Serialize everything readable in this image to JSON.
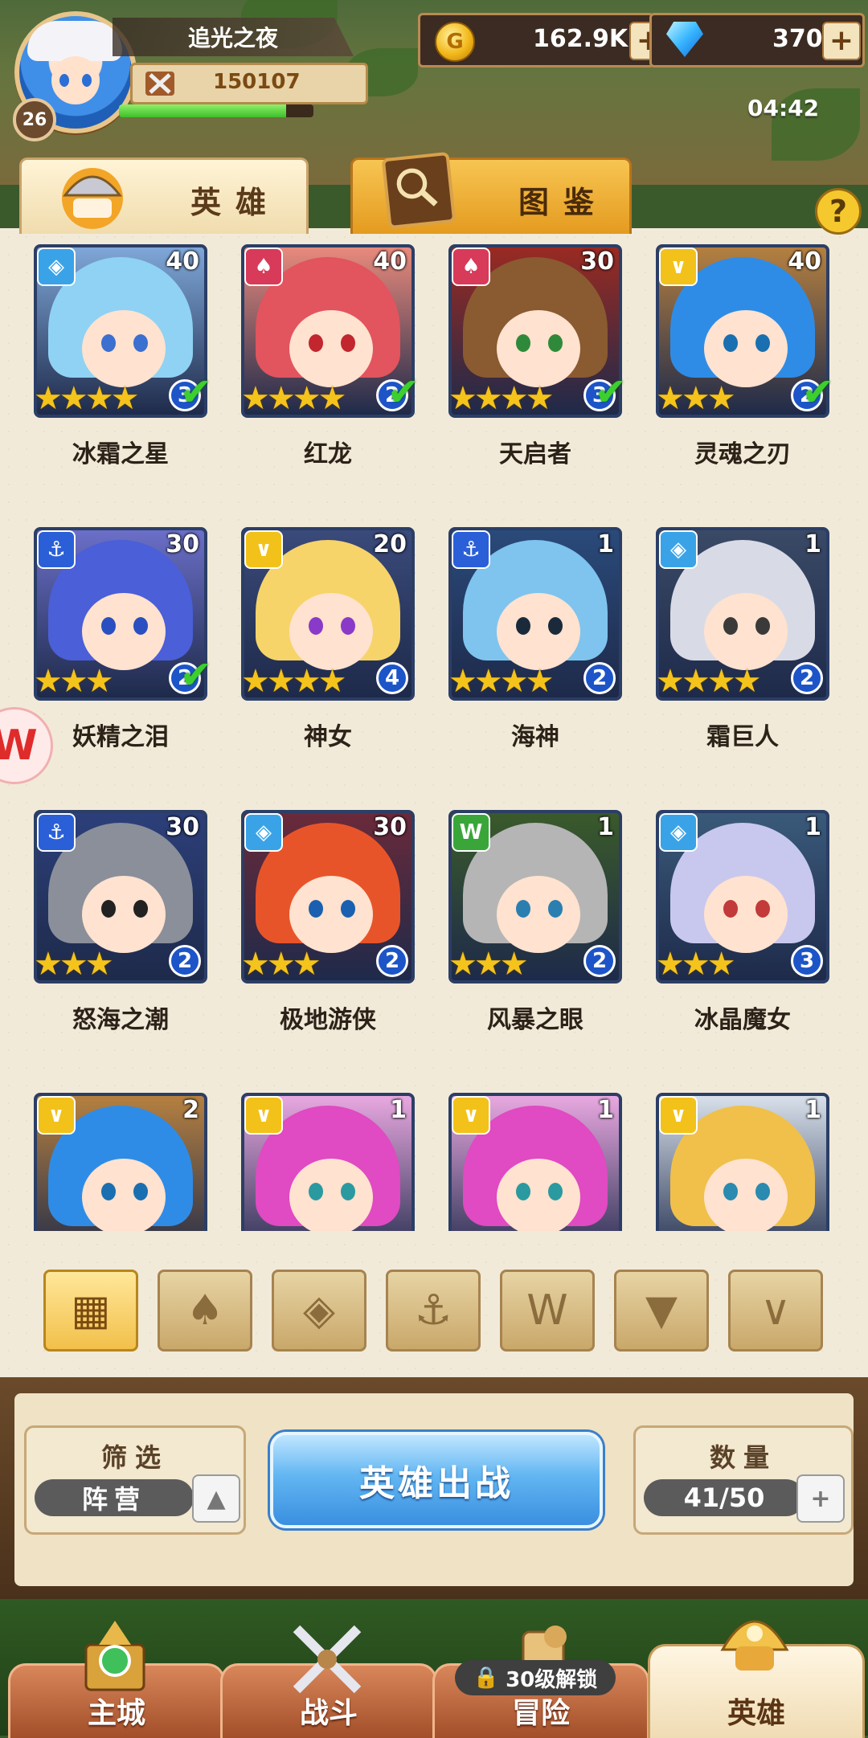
{
  "player": {
    "name": "追光之夜",
    "level": "26",
    "power": "150107",
    "exp_fraction": 0.86
  },
  "resources": {
    "gold": "162.9K",
    "gems": "370",
    "plus": "+"
  },
  "clock": "04:42",
  "tabs": {
    "heroes": "英雄",
    "codex": "图鉴"
  },
  "help": "?",
  "heroes": [
    {
      "name": "冰霜之星",
      "level": "40",
      "stars": 4,
      "rank": "3",
      "checked": true,
      "faction": "crystal-icon",
      "hair": "#8fd2f4",
      "bg": "#7fa7d8",
      "eye": "#3b6fd0"
    },
    {
      "name": "红龙",
      "level": "40",
      "stars": 4,
      "rank": "2",
      "checked": true,
      "faction": "flame-icon",
      "hair": "#e2545e",
      "bg": "#e88a7c",
      "eye": "#c2262e"
    },
    {
      "name": "天启者",
      "level": "30",
      "stars": 4,
      "rank": "3",
      "checked": true,
      "faction": "flame-icon",
      "hair": "#8a5a30",
      "bg": "#9a2a22",
      "eye": "#2e8a3a"
    },
    {
      "name": "灵魂之刃",
      "level": "40",
      "stars": 3,
      "rank": "2",
      "checked": true,
      "faction": "chevron-icon",
      "hair": "#2f8ce6",
      "bg": "#b58040",
      "eye": "#1a6fb0"
    },
    {
      "name": "妖精之泪",
      "level": "30",
      "stars": 3,
      "rank": "2",
      "checked": true,
      "faction": "anchor-icon",
      "hair": "#4a5fd8",
      "bg": "#6b6fc8",
      "eye": "#2a4fc0"
    },
    {
      "name": "神女",
      "level": "20",
      "stars": 4,
      "rank": "4",
      "checked": false,
      "faction": "chevron-icon",
      "hair": "#f6d46a",
      "bg": "#3a4a7a",
      "eye": "#8a3ac8"
    },
    {
      "name": "海神",
      "level": "1",
      "stars": 4,
      "rank": "2",
      "checked": false,
      "faction": "anchor-icon",
      "hair": "#7ec4ee",
      "bg": "#2a4a7a",
      "eye": "#1a2a3a"
    },
    {
      "name": "霜巨人",
      "level": "1",
      "stars": 4,
      "rank": "2",
      "checked": false,
      "faction": "crystal-icon",
      "hair": "#d8dbe6",
      "bg": "#3a4a66",
      "eye": "#3a3a3a"
    },
    {
      "name": "怒海之潮",
      "level": "30",
      "stars": 3,
      "rank": "2",
      "checked": false,
      "faction": "anchor-icon",
      "hair": "#8a8f9a",
      "bg": "#2c3f7a",
      "eye": "#222222"
    },
    {
      "name": "极地游侠",
      "level": "30",
      "stars": 3,
      "rank": "2",
      "checked": false,
      "faction": "crystal-icon",
      "hair": "#e8542a",
      "bg": "#6a2a3a",
      "eye": "#1a5fb0"
    },
    {
      "name": "风暴之眼",
      "level": "1",
      "stars": 3,
      "rank": "2",
      "checked": false,
      "faction": "beast-icon",
      "hair": "#b5b5b5",
      "bg": "#3a5a2a",
      "eye": "#2a7fb0"
    },
    {
      "name": "冰晶魔女",
      "level": "1",
      "stars": 3,
      "rank": "3",
      "checked": false,
      "faction": "crystal-icon",
      "hair": "#c8c8ee",
      "bg": "#3a5a7a",
      "eye": "#c23a3a"
    },
    {
      "name": "",
      "level": "2",
      "stars": 0,
      "rank": "",
      "checked": false,
      "faction": "chevron-icon",
      "hair": "#2f8ce6",
      "bg": "#b58040",
      "eye": "#1a6fb0"
    },
    {
      "name": "",
      "level": "1",
      "stars": 0,
      "rank": "",
      "checked": false,
      "faction": "chevron-icon",
      "hair": "#e04ac2",
      "bg": "#e8a8e0",
      "eye": "#2a9aa0"
    },
    {
      "name": "",
      "level": "1",
      "stars": 0,
      "rank": "",
      "checked": false,
      "faction": "chevron-icon",
      "hair": "#e04ac2",
      "bg": "#e8a8e0",
      "eye": "#2a9aa0"
    },
    {
      "name": "",
      "level": "1",
      "stars": 0,
      "rank": "",
      "checked": false,
      "faction": "chevron-icon",
      "hair": "#f0c04a",
      "bg": "#d8e0ea",
      "eye": "#2a8ab0"
    }
  ],
  "faction_filters": [
    {
      "icon": "grid-all-icon",
      "active": true
    },
    {
      "icon": "flame-icon",
      "active": false
    },
    {
      "icon": "crystal-icon",
      "active": false
    },
    {
      "icon": "anchor-icon",
      "active": false
    },
    {
      "icon": "beast-icon",
      "active": false
    },
    {
      "icon": "demon-icon",
      "active": false
    },
    {
      "icon": "chevron-icon",
      "active": false
    }
  ],
  "filter": {
    "title": "筛选",
    "value": "阵营"
  },
  "deploy_label": "英雄出战",
  "count": {
    "title": "数量",
    "value": "41/50"
  },
  "nav": {
    "city": "主城",
    "battle": "战斗",
    "adventure": "冒险",
    "heroes": "英雄",
    "lock_text": "30级解锁"
  }
}
